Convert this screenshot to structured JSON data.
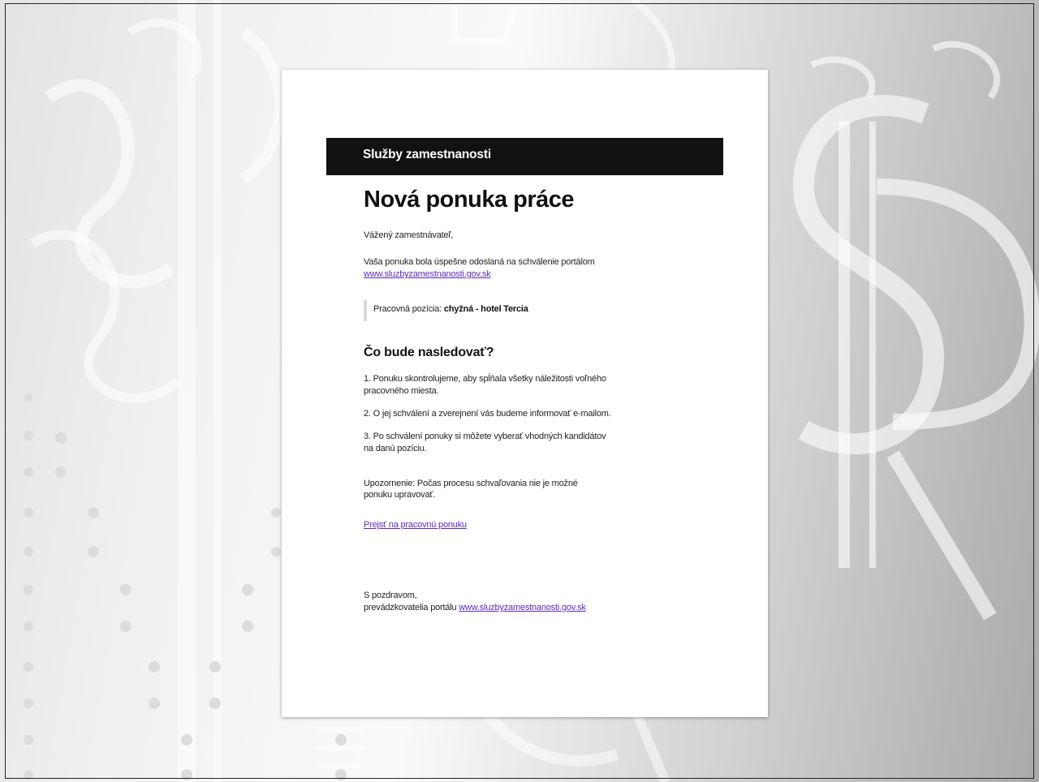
{
  "email": {
    "header_brand": "Služby zamestnanosti",
    "title": "Nová ponuka práce",
    "greeting": "Vážený zamestnávateľ,",
    "sent_text": "Vaša ponuka bola úspešne odoslaná na schválenie portálom",
    "portal_link": "www.sluzbyzamestnanosti.gov.sk",
    "position_label": "Pracovná pozícia: ",
    "position_value": "chyžná - hotel Tercia",
    "next_heading": "Čo bude nasledovať?",
    "steps": [
      "1. Ponuku skontrolujeme, aby spĺňala všetky náležitosti voľného pracovného miesta.",
      "2. O jej schválení a zverejnení vás budeme informovať e-mailom.",
      "3. Po schválení ponuky si môžete vyberať vhodných kandidátov na danú pozíciu."
    ],
    "warning": "Upozornenie: Počas procesu schvaľovania nie je možné ponuku upravovať.",
    "offer_link": "Prejsť na pracovnú ponuku",
    "regards": "S pozdravom,",
    "signature_prefix": "prevádzkovatelia portálu ",
    "signature_link": "www.sluzbyzamestnanosti.gov.sk"
  }
}
